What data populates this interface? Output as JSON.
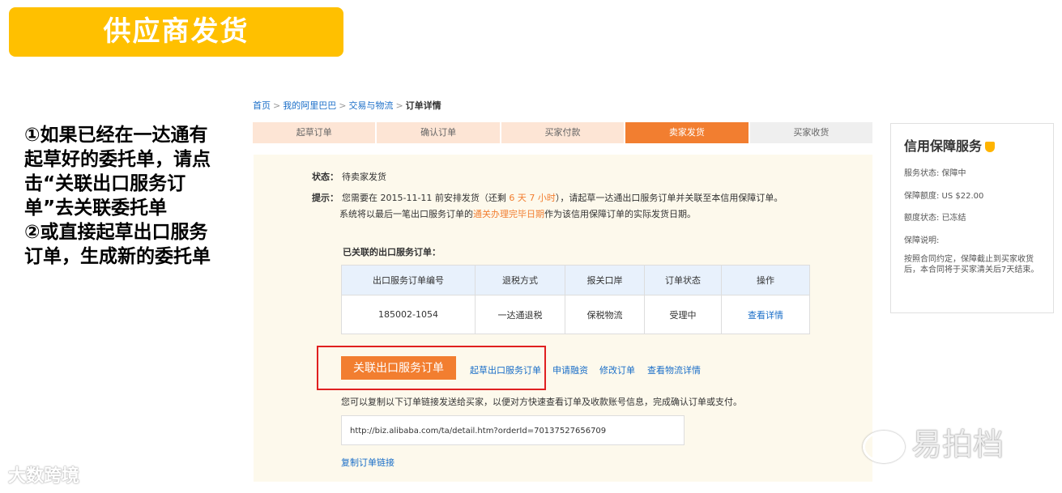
{
  "slide": {
    "title": "供应商发货",
    "note_lines": [
      "①如果已经在一达通有起草好的委托单，请点击“关联出口服务订单”去关联委托单",
      "②或直接起草出口服务订单，生成新的委托单"
    ]
  },
  "breadcrumb": [
    "首页",
    "我的阿里巴巴",
    "交易与物流",
    "订单详情"
  ],
  "steps": [
    "起草订单",
    "确认订单",
    "买家付款",
    "卖家发货",
    "买家收货"
  ],
  "order": {
    "status_label": "状态：",
    "status_value": "待卖家发货",
    "tip_label": "提示：",
    "tip_part1": "您需要在 2015-11-11 前安排发货（还剩 ",
    "tip_remaining": "6 天 7 小时",
    "tip_part2": "），请起草一达通出口服务订单并关联至本信用保障订单。",
    "tip_line2_a": "系统将以最后一笔出口服务订单的",
    "tip_line2_highlight": "通关办理完毕日期",
    "tip_line2_b": "作为该信用保障订单的实际发货日期。",
    "linked_label": "已关联的出口服务订单：",
    "table": {
      "headers": [
        "出口服务订单编号",
        "退税方式",
        "报关口岸",
        "订单状态",
        "操作"
      ],
      "rows": [
        [
          "185002-1054",
          "一达通退税",
          "保税物流",
          "受理中",
          "查看详情"
        ]
      ]
    },
    "link_button": "关联出口服务订单",
    "actions": [
      "起草出口服务订单",
      "申请融资",
      "修改订单",
      "查看物流详情"
    ],
    "copy_tip": "您可以复制以下订单链接发送给买家，以便对方快速查看订单及收款账号信息，完成确认订单或支付。",
    "order_url": "http://biz.alibaba.com/ta/detail.htm?orderId=70137527656709",
    "copy_link": "复制订单链接"
  },
  "side_panel": {
    "title": "信用保障服务",
    "items": [
      "服务状态: 保障中",
      "保障额度: US $22.00",
      "额度状态: 已冻结",
      "保障说明:"
    ],
    "description": "按照合同约定，保障截止到买家收货后，本合同将于买家清关后7天结束。"
  },
  "watermarks": {
    "left": "大数跨境",
    "right": "易拍档"
  },
  "colors": {
    "title_bg": "#ffc000",
    "accent": "#f27e30",
    "link": "#1a6ec8",
    "highlight_box": "#e02020"
  }
}
